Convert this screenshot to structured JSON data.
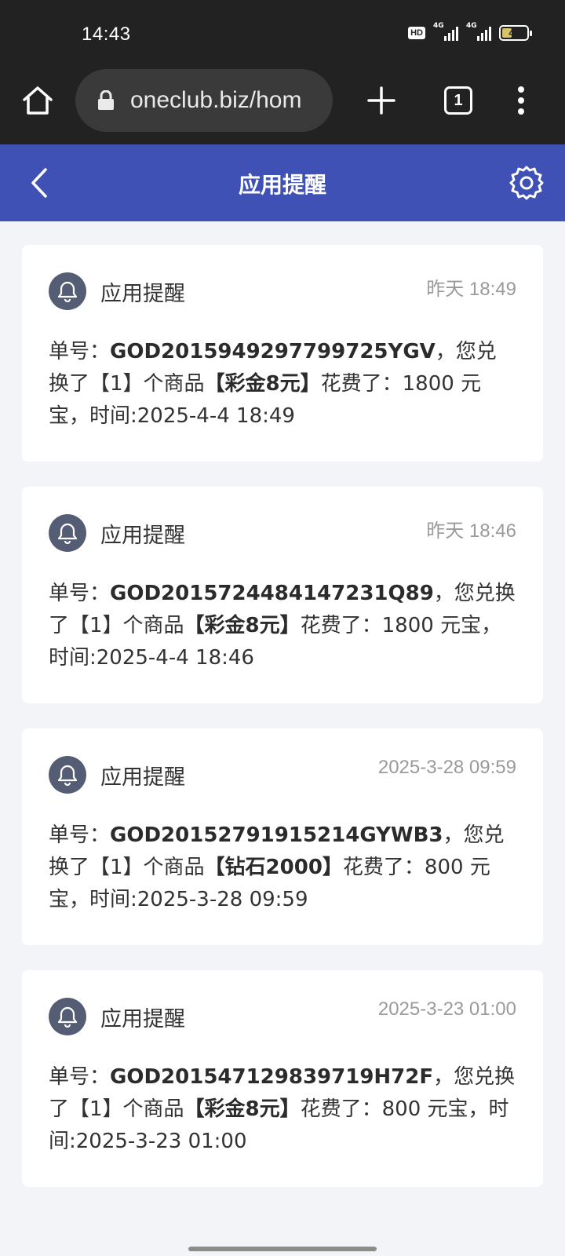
{
  "status_bar": {
    "time": "14:43",
    "hd_label": "HD",
    "network_1": "4G",
    "network_2": "4G",
    "battery_level": "40"
  },
  "browser": {
    "url": "oneclub.biz/hom",
    "tab_count": "1",
    "icons": [
      "home-icon",
      "lock-icon",
      "plus-icon",
      "tabs-icon",
      "more-vert-icon"
    ]
  },
  "header": {
    "title": "应用提醒",
    "accent_color": "#3f51b5",
    "icons": [
      "back-arrow-icon",
      "gear-icon"
    ]
  },
  "notifications": [
    {
      "source": "应用提醒",
      "time": "昨天 18:49",
      "prefix": "单号：",
      "order_no": "GOD2015949297799725YGV",
      "mid1": "，您兑换了【1】个商品",
      "item": "【彩金8元】",
      "mid2": "花费了：1800 元宝，时间:2025-4-4 18:49"
    },
    {
      "source": "应用提醒",
      "time": "昨天 18:46",
      "prefix": "单号：",
      "order_no": "GOD2015724484147231Q89",
      "mid1": "，您兑换了【1】个商品",
      "item": "【彩金8元】",
      "mid2": "花费了：1800 元宝，时间:2025-4-4 18:46"
    },
    {
      "source": "应用提醒",
      "time": "2025-3-28 09:59",
      "prefix": "单号：",
      "order_no": "GOD20152791915214GYWB3",
      "mid1": "，您兑换了【1】个商品",
      "item": "【钻石2000】",
      "mid2": "花费了：800 元宝，时间:2025-3-28 09:59"
    },
    {
      "source": "应用提醒",
      "time": "2025-3-23 01:00",
      "prefix": "单号：",
      "order_no": "GOD201547129839719H72F",
      "mid1": "，您兑换了【1】个商品",
      "item": "【彩金8元】",
      "mid2": "花费了：800 元宝，时间:2025-3-23 01:00"
    }
  ]
}
